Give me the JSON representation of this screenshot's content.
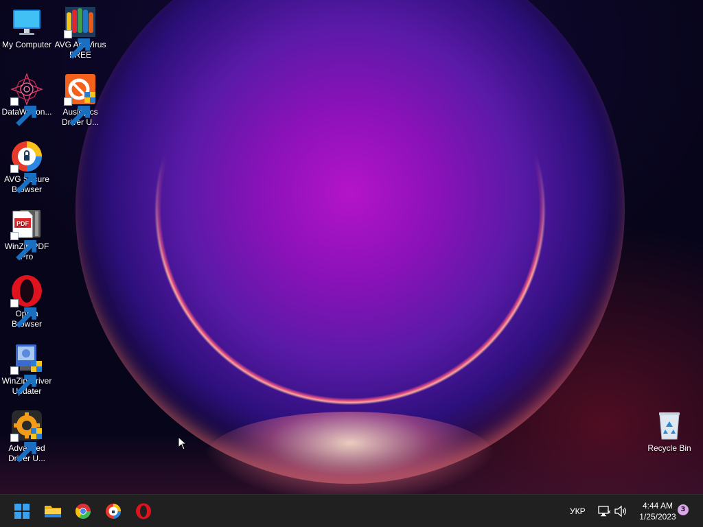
{
  "desktop": {
    "icons": [
      {
        "label": "My Computer",
        "icon": "monitor-icon"
      },
      {
        "label": "AVG AntiVirus FREE",
        "icon": "avg-antivirus-icon"
      },
      {
        "label": "DataWagon...",
        "icon": "datawagon-icon"
      },
      {
        "label": "Auslogics Driver U...",
        "icon": "auslogics-icon"
      },
      {
        "label": "AVG Secure Browser",
        "icon": "avg-browser-icon"
      },
      {
        "label": "WinZip PDF Pro",
        "icon": "winzip-pdf-icon"
      },
      {
        "label": "Opera Browser",
        "icon": "opera-icon"
      },
      {
        "label": "WinZip Driver Updater",
        "icon": "winzip-driver-icon"
      },
      {
        "label": "Advanced Driver U...",
        "icon": "advanced-driver-icon"
      },
      {
        "label": "Recycle Bin",
        "icon": "recycle-bin-icon"
      }
    ]
  },
  "taskbar": {
    "apps": [
      "start-icon",
      "file-explorer-icon",
      "chrome-icon",
      "avg-browser-icon",
      "opera-icon"
    ],
    "language": "УКР",
    "time": "4:44 AM",
    "date": "1/25/2023",
    "notifications": "3"
  },
  "colors": {
    "taskbar": "#202020",
    "start_blue": "#3aa0f0",
    "opera_red": "#e0121e"
  }
}
